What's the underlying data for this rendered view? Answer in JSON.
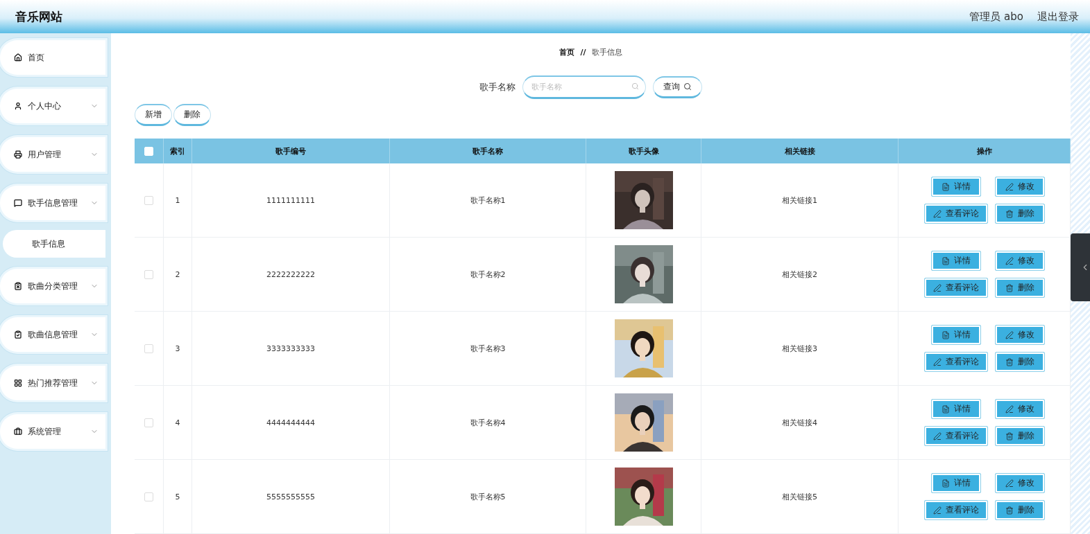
{
  "header": {
    "title": "音乐网站",
    "user": "管理员 abo",
    "logout": "退出登录"
  },
  "sidebar": {
    "items": [
      {
        "label": "首页",
        "expandable": false,
        "selected": false
      },
      {
        "label": "个人中心",
        "expandable": true,
        "selected": false
      },
      {
        "label": "用户管理",
        "expandable": true,
        "selected": false
      },
      {
        "label": "歌手信息管理",
        "expandable": true,
        "selected": false,
        "children": [
          {
            "label": "歌手信息",
            "selected": true
          }
        ]
      },
      {
        "label": "歌曲分类管理",
        "expandable": true,
        "selected": false
      },
      {
        "label": "歌曲信息管理",
        "expandable": true,
        "selected": false
      },
      {
        "label": "热门推荐管理",
        "expandable": true,
        "selected": false
      },
      {
        "label": "系统管理",
        "expandable": true,
        "selected": false
      }
    ]
  },
  "breadcrumb": {
    "items": [
      "首页",
      "歌手信息"
    ],
    "separator": "//"
  },
  "search": {
    "label": "歌手名称",
    "placeholder": "歌手名称",
    "button": "查询"
  },
  "toolbar": {
    "buttons": [
      "新增",
      "删除"
    ]
  },
  "table": {
    "select_all": {
      "checked": false
    },
    "columns": [
      "索引",
      "歌手编号",
      "歌手名称",
      "歌手头像",
      "相关链接",
      "操作"
    ],
    "rows": [
      {
        "checked": false,
        "index": "1",
        "code": "1111111111",
        "name": "歌手名称1",
        "avatar": {
          "kind": "picture"
        },
        "link": "相关链接1",
        "actions": [
          {
            "kind": "detail",
            "label": "详情"
          },
          {
            "kind": "edit",
            "label": "修改"
          },
          {
            "kind": "comments",
            "label": "查看评论"
          },
          {
            "kind": "delete",
            "label": "删除"
          }
        ]
      },
      {
        "checked": false,
        "index": "2",
        "code": "2222222222",
        "name": "歌手名称2",
        "avatar": {
          "kind": "picture"
        },
        "link": "相关链接2",
        "actions": [
          {
            "kind": "detail",
            "label": "详情"
          },
          {
            "kind": "edit",
            "label": "修改"
          },
          {
            "kind": "comments",
            "label": "查看评论"
          },
          {
            "kind": "delete",
            "label": "删除"
          }
        ]
      },
      {
        "checked": false,
        "index": "3",
        "code": "3333333333",
        "name": "歌手名称3",
        "avatar": {
          "kind": "picture"
        },
        "link": "相关链接3",
        "actions": [
          {
            "kind": "detail",
            "label": "详情"
          },
          {
            "kind": "edit",
            "label": "修改"
          },
          {
            "kind": "comments",
            "label": "查看评论"
          },
          {
            "kind": "delete",
            "label": "删除"
          }
        ]
      },
      {
        "checked": false,
        "index": "4",
        "code": "4444444444",
        "name": "歌手名称4",
        "avatar": {
          "kind": "picture"
        },
        "link": "相关链接4",
        "actions": [
          {
            "kind": "detail",
            "label": "详情"
          },
          {
            "kind": "edit",
            "label": "修改"
          },
          {
            "kind": "comments",
            "label": "查看评论"
          },
          {
            "kind": "delete",
            "label": "删除"
          }
        ]
      },
      {
        "checked": false,
        "index": "5",
        "code": "5555555555",
        "name": "歌手名称5",
        "avatar": {
          "kind": "picture"
        },
        "link": "相关链接5",
        "actions": [
          {
            "kind": "detail",
            "label": "详情"
          },
          {
            "kind": "edit",
            "label": "修改"
          },
          {
            "kind": "comments",
            "label": "查看评论"
          },
          {
            "kind": "delete",
            "label": "删除"
          }
        ]
      }
    ]
  }
}
